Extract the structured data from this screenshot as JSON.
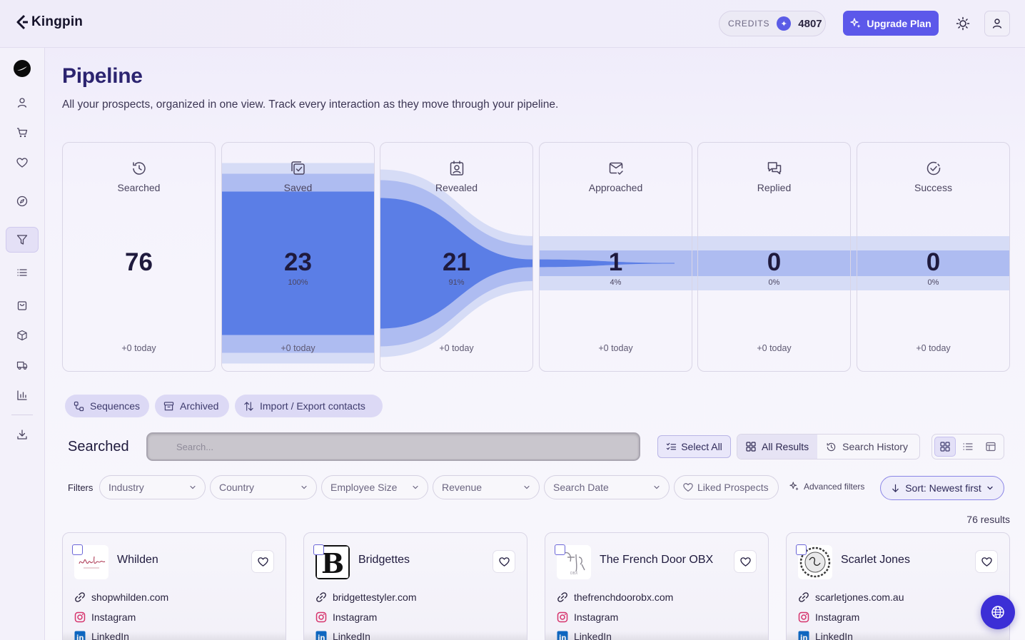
{
  "app": {
    "name": "Kingpin"
  },
  "topbar": {
    "credits_label": "CREDITS",
    "credits_value": "4807",
    "upgrade_label": "Upgrade Plan"
  },
  "header": {
    "title": "Pipeline",
    "description": "All your prospects, organized in one view. Track every interaction as they move through your pipeline."
  },
  "funnel": {
    "stages": [
      {
        "name": "Searched",
        "count": "76",
        "pct": "",
        "today": "+0 today",
        "icon": "history-icon"
      },
      {
        "name": "Saved",
        "count": "23",
        "pct": "100%",
        "today": "+0 today",
        "icon": "saved-check-icon"
      },
      {
        "name": "Revealed",
        "count": "21",
        "pct": "91%",
        "today": "+0 today",
        "icon": "reveal-contact-icon"
      },
      {
        "name": "Approached",
        "count": "1",
        "pct": "4%",
        "today": "+0 today",
        "icon": "mail-check-icon"
      },
      {
        "name": "Replied",
        "count": "0",
        "pct": "0%",
        "today": "+0 today",
        "icon": "chat-bubbles-icon"
      },
      {
        "name": "Success",
        "count": "0",
        "pct": "0%",
        "today": "+0 today",
        "icon": "check-badge-icon"
      }
    ],
    "fill_ratio": [
      0,
      1.0,
      0.91,
      0.04,
      0,
      0
    ]
  },
  "tabs": [
    {
      "label": "Sequences",
      "icon": "sequences-icon"
    },
    {
      "label": "Archived",
      "icon": "archive-icon"
    },
    {
      "label": "Import / Export contacts",
      "icon": "import-export-icon"
    }
  ],
  "toolbar": {
    "section_title": "Searched",
    "search_placeholder": "Search...",
    "select_all_label": "Select All",
    "all_results_label": "All Results",
    "search_history_label": "Search History"
  },
  "filters": {
    "label": "Filters",
    "dropdowns": [
      "Industry",
      "Country",
      "Employee Size",
      "Revenue",
      "Search Date"
    ],
    "liked_label": "Liked Prospects",
    "advanced_label": "Advanced filters",
    "sort_label": "Sort: Newest first"
  },
  "results_count": "76 results",
  "cards": [
    {
      "name": "Whilden",
      "website": "shopwhilden.com",
      "instagram": "Instagram",
      "linkedin": "LinkedIn"
    },
    {
      "name": "Bridgettes",
      "website": "bridgettestyler.com",
      "instagram": "Instagram",
      "linkedin": "LinkedIn"
    },
    {
      "name": "The French Door OBX",
      "website": "thefrenchdoorobx.com",
      "instagram": "Instagram",
      "linkedin": "LinkedIn"
    },
    {
      "name": "Scarlet Jones",
      "website": "scarletjones.com.au",
      "instagram": "Instagram",
      "linkedin": "LinkedIn"
    }
  ],
  "colors": {
    "accent": "#5c58ea",
    "funnel_main": "#5b7ee6",
    "funnel_mid": "#aebcf1",
    "funnel_light": "#d6dcf6",
    "title": "#2c2470"
  }
}
